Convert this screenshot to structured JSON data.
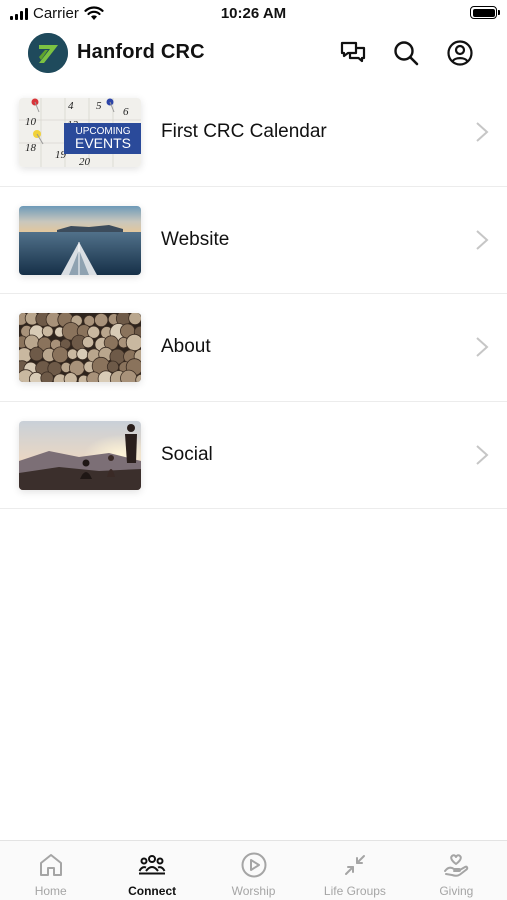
{
  "status_bar": {
    "carrier": "Carrier",
    "time": "10:26 AM"
  },
  "header": {
    "title": "Hanford CRC",
    "icons": [
      "chat-icon",
      "search-icon",
      "profile-icon"
    ]
  },
  "thumbnails": {
    "calendar_banner_line1": "UPCOMING",
    "calendar_banner_line2": "EVENTS",
    "calendar_dates": [
      "4",
      "5",
      "6",
      "10",
      "12",
      "18",
      "19",
      "20"
    ]
  },
  "list": {
    "items": [
      {
        "label": "First CRC Calendar"
      },
      {
        "label": "Website"
      },
      {
        "label": "About"
      },
      {
        "label": "Social"
      }
    ]
  },
  "tab_bar": {
    "active": "Connect",
    "tabs": [
      {
        "label": "Home",
        "icon": "home-icon"
      },
      {
        "label": "Connect",
        "icon": "people-icon"
      },
      {
        "label": "Worship",
        "icon": "play-circle-icon"
      },
      {
        "label": "Life Groups",
        "icon": "collapse-arrows-icon"
      },
      {
        "label": "Giving",
        "icon": "giving-hand-icon"
      }
    ]
  },
  "colors": {
    "active_tab": "#111111",
    "inactive_tab": "#a5a5a5",
    "logo_background": "#1f4a5c",
    "logo_accent": "#7cc242",
    "calendar_banner": "#2a4a9a"
  }
}
